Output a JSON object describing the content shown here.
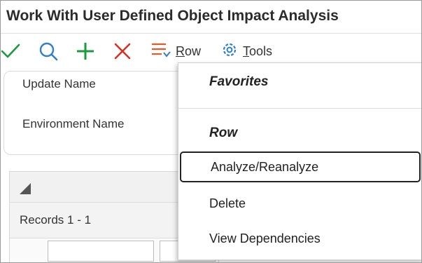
{
  "window": {
    "title": "Work With User Defined Object Impact Analysis"
  },
  "toolbar": {
    "row_menu": {
      "label_first": "R",
      "label_rest": "ow"
    },
    "tools_menu": {
      "label_first": "T",
      "label_rest": "ools"
    }
  },
  "form": {
    "update_name_label": "Update Name",
    "environment_name_label": "Environment Name"
  },
  "grid": {
    "records_label": "Records 1 - 1"
  },
  "row_dropdown": {
    "favorites_header": "Favorites",
    "row_header": "Row",
    "items": [
      "Analyze/Reanalyze",
      "Delete",
      "View Dependencies"
    ],
    "selected_item": "Analyze/Reanalyze"
  },
  "colors": {
    "ok_icon": "#1a9b3c",
    "search_icon": "#2f80c9",
    "add_icon": "#1a9b3c",
    "delete_icon": "#d93025",
    "row_icon": "#e05a2b",
    "tools_icon": "#2f80c9"
  }
}
